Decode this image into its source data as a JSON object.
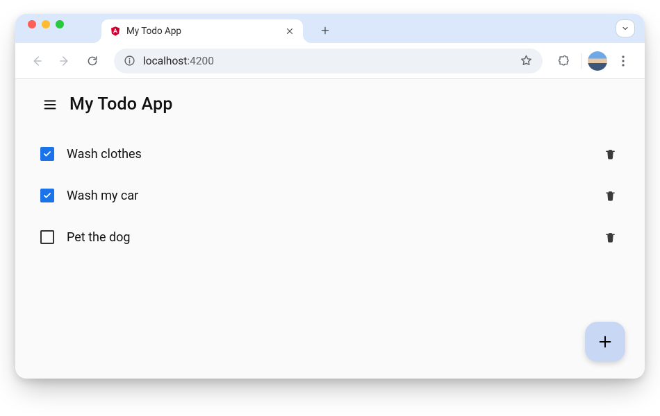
{
  "browser": {
    "tab": {
      "title": "My Todo App"
    },
    "address": {
      "host": "localhost",
      "port": ":4200"
    }
  },
  "app": {
    "title": "My Todo App",
    "todos": [
      {
        "label": "Wash clothes",
        "done": true
      },
      {
        "label": "Wash my car",
        "done": true
      },
      {
        "label": "Pet the dog",
        "done": false
      }
    ]
  }
}
